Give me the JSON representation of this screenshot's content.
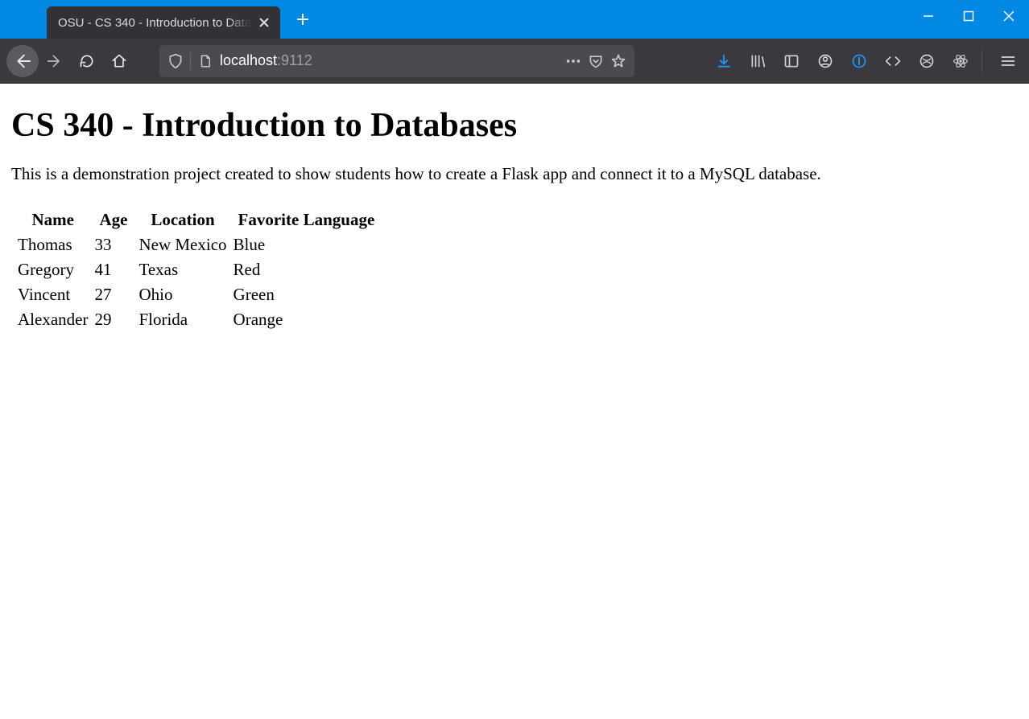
{
  "browser": {
    "tab_title": "OSU - CS 340 - Introduction to Data",
    "url_host": "localhost",
    "url_port": ":9112"
  },
  "page": {
    "heading": "CS 340 - Introduction to Databases",
    "intro": "This is a demonstration project created to show students how to create a Flask app and connect it to a MySQL database.",
    "columns": [
      "Name",
      "Age",
      "Location",
      "Favorite Language"
    ],
    "rows": [
      {
        "name": "Thomas",
        "age": "33",
        "location": "New Mexico",
        "lang": "Blue"
      },
      {
        "name": "Gregory",
        "age": "41",
        "location": "Texas",
        "lang": "Red"
      },
      {
        "name": "Vincent",
        "age": "27",
        "location": "Ohio",
        "lang": "Green"
      },
      {
        "name": "Alexander",
        "age": "29",
        "location": "Florida",
        "lang": "Orange"
      }
    ]
  }
}
